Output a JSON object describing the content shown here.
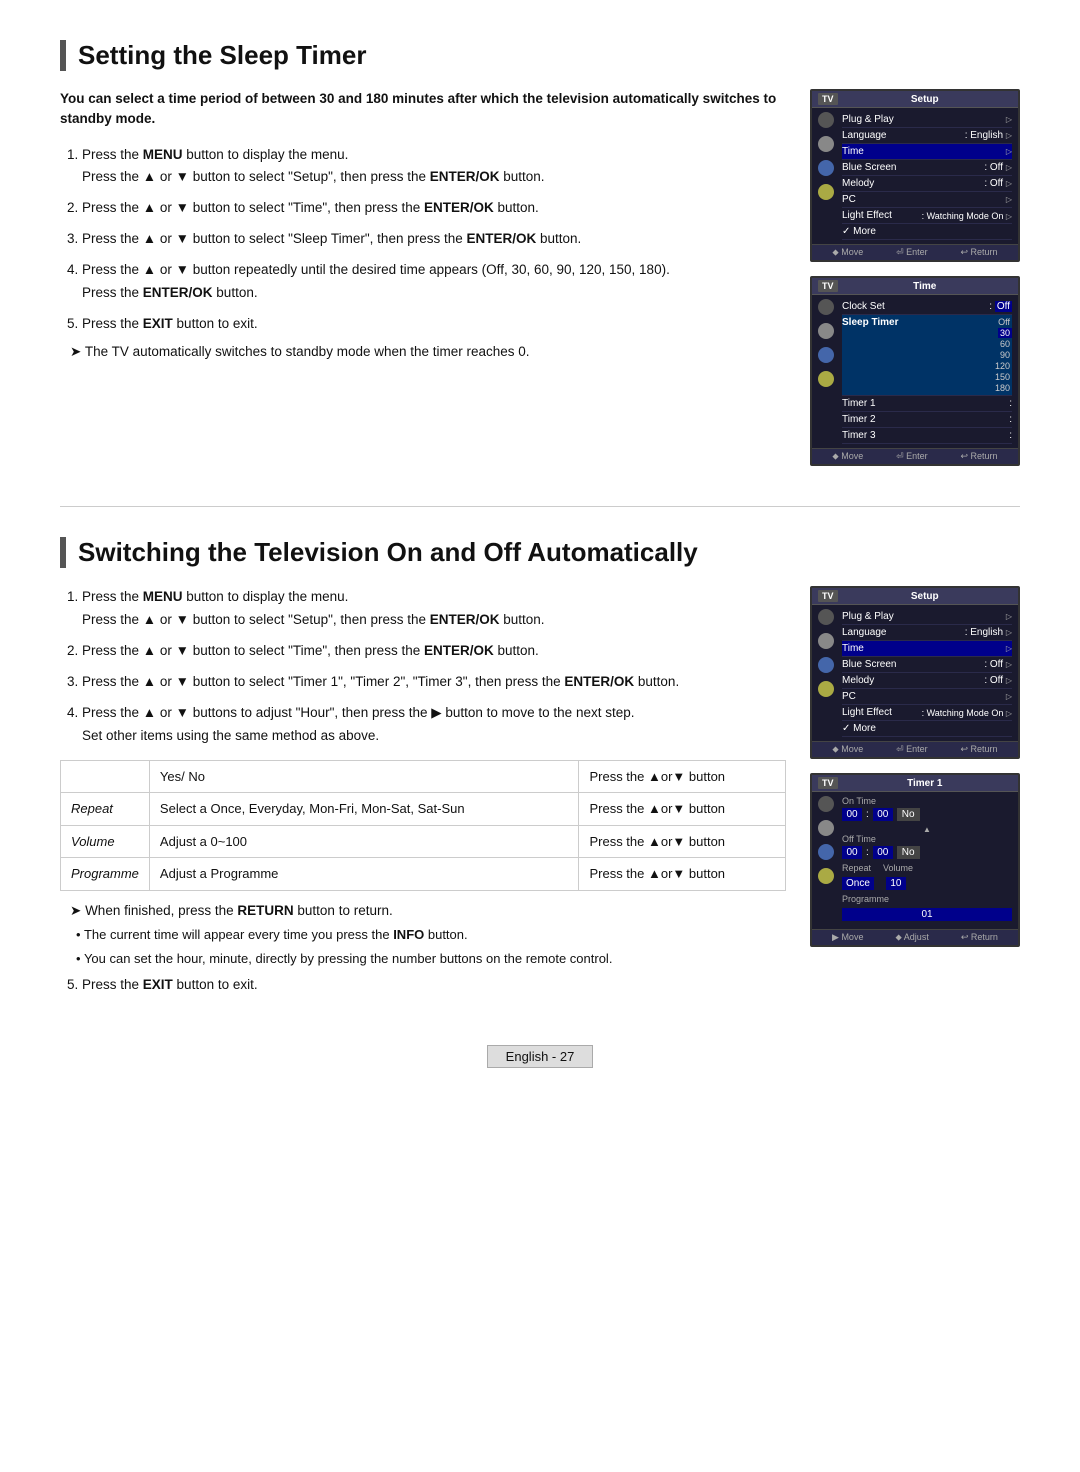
{
  "section1": {
    "title": "Setting the Sleep Timer",
    "intro": "You can select a time period of between 30 and 180 minutes after which the television automatically switches to standby mode.",
    "steps": [
      {
        "id": 1,
        "text": "Press the ",
        "bold": "MENU",
        "text2": " button to display the menu.",
        "sub": "Press the ▲ or ▼ button to select \"Setup\", then press the ",
        "subBold": "ENTER/OK",
        "subEnd": " button."
      },
      {
        "id": 2,
        "text": "Press the ▲ or ▼ button to select \"Time\", then press the ",
        "bold": "ENTER/OK",
        "text2": " button."
      },
      {
        "id": 3,
        "text": "Press the ▲ or ▼ button to select \"Sleep Timer\", then press the ",
        "bold": "ENTER/OK",
        "text2": " button."
      },
      {
        "id": 4,
        "text": "Press the ▲ or ▼ button repeatedly until the desired time appears (Off, 30, 60, 90, 120, 150, 180).",
        "sub": "Press the ",
        "subBold": "ENTER/OK",
        "subEnd": " button."
      },
      {
        "id": 5,
        "text": "Press the ",
        "bold": "EXIT",
        "text2": " button to exit."
      }
    ],
    "note": "The TV automatically switches to standby mode when the timer reaches 0.",
    "screen1": {
      "header_label": "TV",
      "header_title": "Setup",
      "rows": [
        {
          "icon": true,
          "label": "Plug & Play",
          "value": "",
          "arrow": "▷"
        },
        {
          "icon": false,
          "label": "Language",
          "value": ": English",
          "arrow": "▷"
        },
        {
          "icon": false,
          "label": "Time",
          "value": "",
          "arrow": "▷"
        },
        {
          "icon": true,
          "label": "Blue Screen",
          "value": ": Off",
          "arrow": "▷"
        },
        {
          "icon": false,
          "label": "Melody",
          "value": ": Off",
          "arrow": "▷"
        },
        {
          "icon": false,
          "label": "PC",
          "value": "",
          "arrow": "▷"
        },
        {
          "icon": true,
          "label": "Light Effect",
          "value": ": Watching Mode On",
          "arrow": "▷"
        },
        {
          "icon": false,
          "label": "✓ More",
          "value": "",
          "arrow": ""
        }
      ],
      "footer": [
        "⬥ Move",
        "⏎ Enter",
        "↩ Return"
      ]
    },
    "screen2": {
      "header_label": "TV",
      "header_title": "Time",
      "rows": [
        {
          "icon": true,
          "label": "Clock Set",
          "value": ":",
          "extra": "Off",
          "highlight": false
        },
        {
          "icon": false,
          "label": "Sleep Timer",
          "value": "",
          "highlight": true,
          "sleep_values": [
            "Off",
            "30",
            "60",
            "90",
            "120",
            "150",
            "180"
          ],
          "highlighted_index": 1
        },
        {
          "icon": true,
          "label": "Timer 1",
          "value": ":",
          "extra": ""
        },
        {
          "icon": false,
          "label": "Timer 2",
          "value": ":",
          "extra": ""
        },
        {
          "icon": false,
          "label": "Timer 3",
          "value": ":",
          "extra": ""
        },
        {
          "icon": true,
          "label": "",
          "value": "",
          "extra": ""
        },
        {
          "icon": false,
          "label": "",
          "value": "",
          "extra": ""
        }
      ],
      "footer": [
        "⬥ Move",
        "⏎ Enter",
        "↩ Return"
      ]
    }
  },
  "section2": {
    "title": "Switching the Television On and Off Automatically",
    "steps": [
      {
        "id": 1,
        "text": "Press the ",
        "bold": "MENU",
        "text2": " button to display the menu.",
        "sub": "Press the ▲ or ▼ button to select \"Setup\", then press the ",
        "subBold": "ENTER/OK",
        "subEnd": " button."
      },
      {
        "id": 2,
        "text": "Press the ▲ or ▼ button to select \"Time\", then press the ",
        "bold": "ENTER/OK",
        "text2": " button."
      },
      {
        "id": 3,
        "text": "Press the ▲ or ▼ button to select \"Timer 1\", \"Timer 2\", \"Timer 3\", then press the ",
        "bold": "ENTER/OK",
        "text2": " button."
      },
      {
        "id": 4,
        "text": "Press the ▲ or ▼ buttons to adjust \"Hour\", then press the ▶ button to move to the next step.",
        "sub": "Set other items using the same method as above."
      }
    ],
    "table": {
      "rows": [
        {
          "col1": "",
          "col2": "Yes/ No",
          "col3": "Press the ▲or▼ button"
        },
        {
          "col1": "Repeat",
          "col2": "Select a Once, Everyday, Mon-Fri, Mon-Sat, Sat-Sun",
          "col3": "Press the ▲or▼ button"
        },
        {
          "col1": "Volume",
          "col2": "Adjust a 0~100",
          "col3": "Press the ▲or▼ button"
        },
        {
          "col1": "Programme",
          "col2": "Adjust a Programme",
          "col3": "Press the ▲or▼ button"
        }
      ]
    },
    "notes": [
      "When finished, press the RETURN button to return.",
      "The current time will appear every time you press the INFO button.",
      "You can set the hour, minute, directly by pressing the number buttons on the remote control."
    ],
    "step5": {
      "id": 5,
      "text": "Press the ",
      "bold": "EXIT",
      "text2": " button to exit."
    },
    "screen3": {
      "header_label": "TV",
      "header_title": "Setup",
      "rows": [
        {
          "label": "Plug & Play",
          "value": "",
          "arrow": "▷"
        },
        {
          "label": "Language",
          "value": ": English",
          "arrow": "▷"
        },
        {
          "label": "Time",
          "value": "",
          "arrow": "▷"
        },
        {
          "label": "Blue Screen",
          "value": ": Off",
          "arrow": "▷"
        },
        {
          "label": "Melody",
          "value": ": Off",
          "arrow": "▷"
        },
        {
          "label": "PC",
          "value": "",
          "arrow": "▷"
        },
        {
          "label": "Light Effect",
          "value": ": Watching Mode On",
          "arrow": "▷"
        },
        {
          "label": "✓ More",
          "value": "",
          "arrow": ""
        }
      ],
      "footer": [
        "⬥ Move",
        "⏎ Enter",
        "↩ Return"
      ]
    },
    "screen4": {
      "header_label": "TV",
      "header_title": "Timer 1",
      "on_time_label": "On Time",
      "on_hour": "00",
      "on_min": "00",
      "on_no": "No",
      "off_time_label": "Off Time",
      "off_hour": "00",
      "off_min": "00",
      "off_no": "No",
      "repeat_label": "Repeat",
      "volume_label": "Volume",
      "repeat_val": "Once",
      "volume_val": "10",
      "programme_label": "Programme",
      "programme_val": "01",
      "footer": [
        "▶ Move",
        "⬥ Adjust",
        "↩ Return"
      ]
    }
  },
  "footer": {
    "text": "English - 27"
  }
}
